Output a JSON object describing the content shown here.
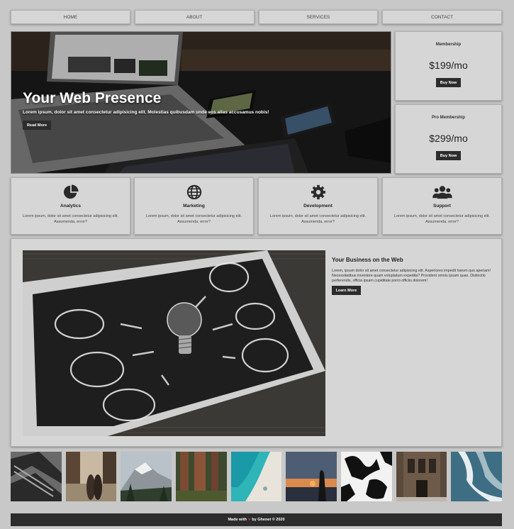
{
  "nav": {
    "items": [
      "HOME",
      "ABOUT",
      "SERVICES",
      "CONTACT"
    ]
  },
  "hero": {
    "title": "Your Web Presence",
    "text": "Lorem ipsum, dolor sit amet consectetur adipisicing elit. Molestias quibusdam unde eos alias accusamus nobis!",
    "button": "Read More"
  },
  "pricing": [
    {
      "title": "Membership",
      "price": "$199/mo",
      "button": "Buy Now"
    },
    {
      "title": "Pro Membership",
      "price": "$299/mo",
      "button": "Buy Now"
    }
  ],
  "features": [
    {
      "icon": "pie-chart-icon",
      "title": "Analytics",
      "text": "Lorem ipsum, dolor sit amet consectetur adipisicing elit. Assumenda, error?"
    },
    {
      "icon": "globe-icon",
      "title": "Marketing",
      "text": "Lorem ipsum, dolor sit amet consectetur adipisicing elit. Assumenda, error?"
    },
    {
      "icon": "cog-icon",
      "title": "Development",
      "text": "Lorem ipsum, dolor sit amet consectetur adipisicing elit. Assumenda, error?"
    },
    {
      "icon": "users-icon",
      "title": "Support",
      "text": "Lorem ipsum, dolor sit amet consectetur adipisicing elit. Assumenda, error?"
    }
  ],
  "business": {
    "title": "Your Business on the Web",
    "text": "Lorem, ipsum dolor sit amet consectetur adipisicing elit. Asperiores impedit harum quo aperiam! Necessitatibus inventore quam voluptatum expedita? Provident omnis ipsam quas. Distinctio perferendis, officia ipsam cupiditate porro officiis dolorem!",
    "button": "Learn More"
  },
  "gallery": {
    "count": 9
  },
  "footer": {
    "prefix": "Made with",
    "heart": "♥",
    "suffix": "by Ghenet © 2020"
  },
  "colors": {
    "page_bg": "#c8c8c8",
    "card_bg": "#d6d6d6",
    "button_dark": "#2c2c2c",
    "heart": "#e0304a"
  }
}
